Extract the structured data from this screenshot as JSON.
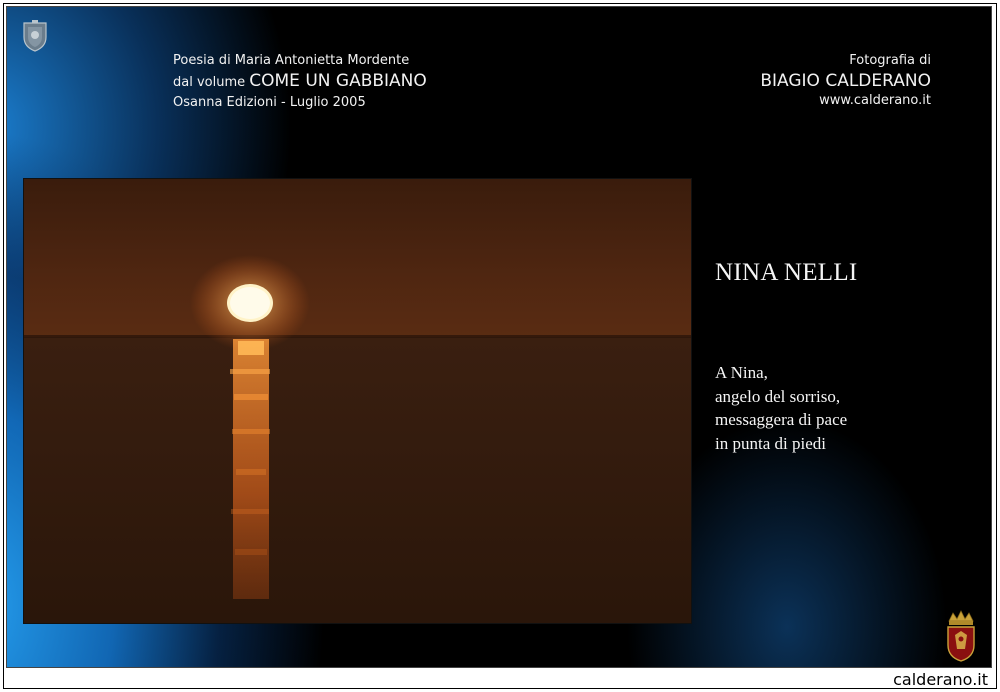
{
  "header": {
    "left_line1": "Poesia di Maria Antonietta Mordente",
    "left_line2_prefix": "dal volume ",
    "left_line2_title": "COME UN GABBIANO",
    "left_line3": "Osanna Edizioni - Luglio 2005",
    "right_line1": "Fotografia di",
    "right_line2": "BIAGIO CALDERANO",
    "right_line3": "www.calderano.it"
  },
  "poem": {
    "title": "NINA NELLI",
    "lines": [
      "A Nina,",
      "angelo del sorriso,",
      "messaggera di pace",
      "in punta di piedi"
    ]
  },
  "footer": {
    "site": "calderano.it"
  },
  "icons": {
    "top_left": "crest-emblem-icon",
    "bottom_right": "crowned-coat-of-arms-icon"
  },
  "colors": {
    "accent_blue": "#1e8fe6",
    "sun": "#ffe7a8",
    "sky": "#4a2410",
    "text": "#f2f2f2"
  }
}
